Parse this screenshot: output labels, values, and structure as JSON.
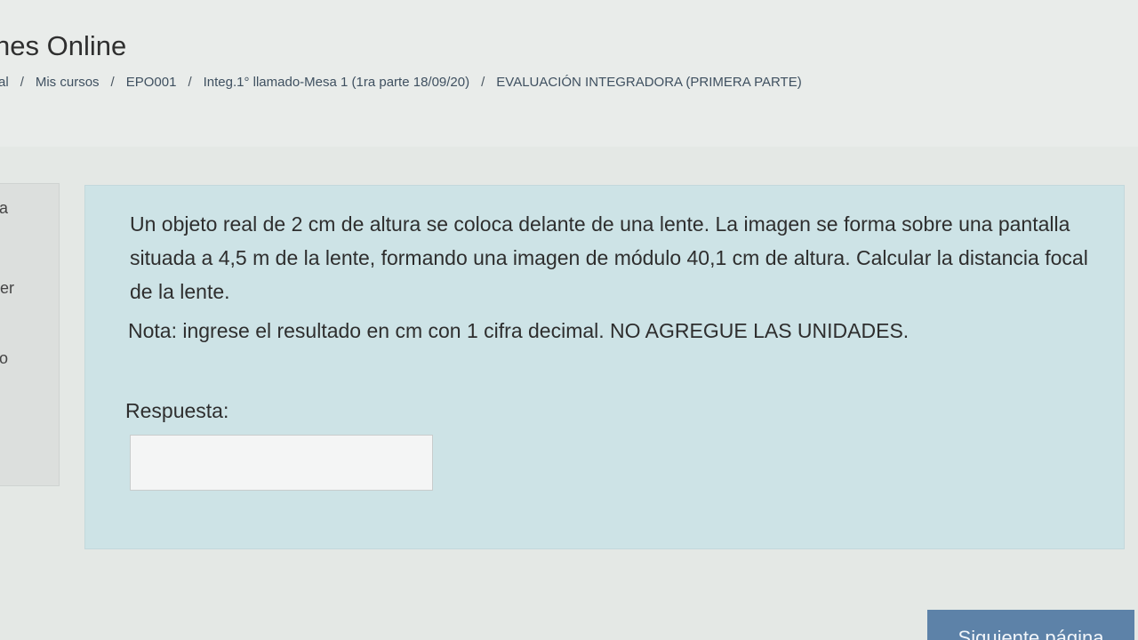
{
  "header": {
    "site_title": "nes Online",
    "breadcrumb": [
      "al",
      "Mis cursos",
      "EPO001",
      "Integ.1° llamado-Mesa 1 (1ra parte 18/09/20)",
      "EVALUACIÓN INTEGRADORA (PRIMERA PARTE)"
    ],
    "breadcrumb_separator": "/"
  },
  "left_panel": {
    "fragments": [
      "a",
      "er",
      "o"
    ]
  },
  "question": {
    "text": "Un objeto real de 2 cm de altura se coloca delante de una lente. La imagen se forma sobre una pantalla situada a 4,5 m de la lente, formando una imagen de módulo  40,1 cm de altura. Calcular la distancia focal de la lente.",
    "note": "Nota: ingrese el resultado en cm con 1 cifra decimal. NO AGREGUE LAS UNIDADES.",
    "answer_label": "Respuesta:",
    "answer_value": ""
  },
  "footer": {
    "next_button_label": "Siguiente página"
  },
  "colors": {
    "question_background": "#cde3e6",
    "button_background": "#5d82a8"
  }
}
